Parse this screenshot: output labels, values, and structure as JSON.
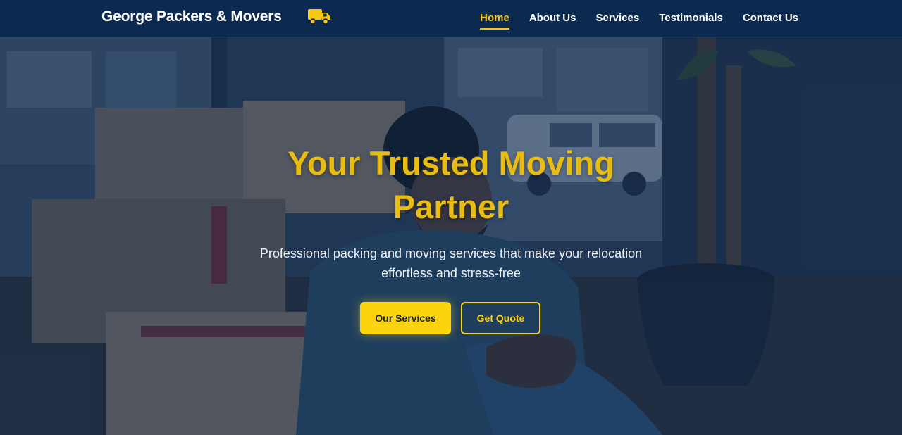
{
  "brand": {
    "name": "George Packers & Movers",
    "icon": "truck-icon",
    "accent_color": "#f7c815"
  },
  "nav": {
    "items": [
      {
        "label": "Home",
        "active": true
      },
      {
        "label": "About Us",
        "active": false
      },
      {
        "label": "Services",
        "active": false
      },
      {
        "label": "Testimonials",
        "active": false
      },
      {
        "label": "Contact Us",
        "active": false
      }
    ]
  },
  "hero": {
    "title": "Your Trusted Moving Partner",
    "subtitle": "Professional packing and moving services that make your relocation effortless and stress-free",
    "primary_button": "Our Services",
    "secondary_button": "Get Quote"
  }
}
